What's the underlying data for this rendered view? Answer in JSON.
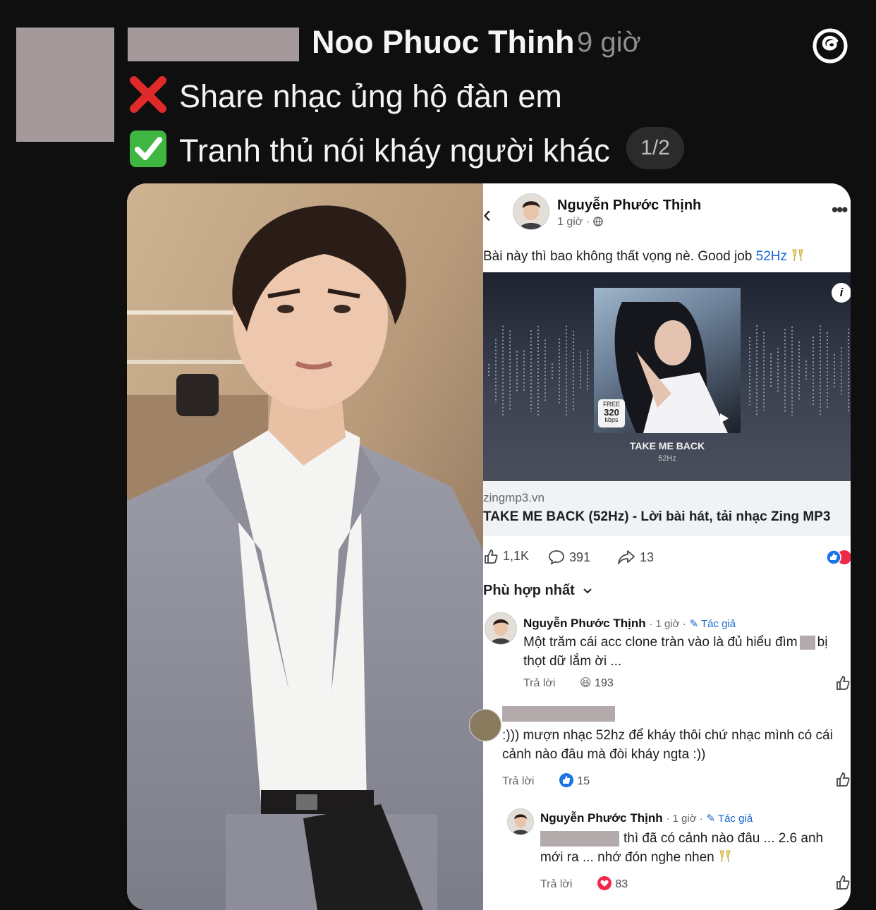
{
  "post": {
    "author": "Noo Phuoc Thinh",
    "time": "9 giờ",
    "line1": "Share nhạc ủng hộ đàn em",
    "line2": "Tranh thủ nói kháy người khác",
    "page_indicator": "1/2",
    "icons": {
      "x_emoji": "cross-mark-icon",
      "check_emoji": "check-mark-icon",
      "logo": "threads-logo-icon"
    }
  },
  "screenshot": {
    "author": "Nguyễn Phước Thịnh",
    "time": "1 giờ ·",
    "caption": "Bài này thì bao không thất vọng nè. Good job",
    "caption_tag": "52Hz",
    "album_badge_top": "FREE",
    "album_badge_main": "320",
    "album_badge_bottom": "kbps",
    "song_title": "TAKE ME BACK",
    "song_artist": "52Hz",
    "link_domain": "zingmp3.vn",
    "link_title": "TAKE ME BACK (52Hz) - Lời bài hát, tải nhạc Zing MP3",
    "likes": "1,1K",
    "comments": "391",
    "shares": "13",
    "sort_label": "Phù hợp nhất",
    "comment_list": [
      {
        "name": "Nguyễn Phước Thịnh",
        "meta": "· 1 giờ ·",
        "tag": "Tác giả",
        "text_a": "Một trăm cái acc clone tràn vào là đủ hiểu đìm",
        "text_b": "bị",
        "text_c": "thọt dữ lắm ời ...",
        "reply": "Trả lời",
        "count": "193"
      },
      {
        "text": ":))) mượn nhạc 52hz để kháy thôi chứ nhạc mình có cái cảnh nào đâu mà đòi kháy ngta :))",
        "reply": "Trả lời",
        "count": "15"
      },
      {
        "name": "Nguyễn Phước Thịnh",
        "meta": "· 1 giờ ·",
        "tag": "Tác giả",
        "text_a": "thì đã có cảnh nào đâu ... 2.6 anh",
        "text_b": "mới ra ... nhớ đón nghe nhen",
        "reply": "Trả lời",
        "count": "83"
      }
    ]
  },
  "colors": {
    "background": "#0f0f0f",
    "redaction": "#a59a9b",
    "fb_blue": "#1a66d2",
    "muted": "#8e8e8e"
  }
}
